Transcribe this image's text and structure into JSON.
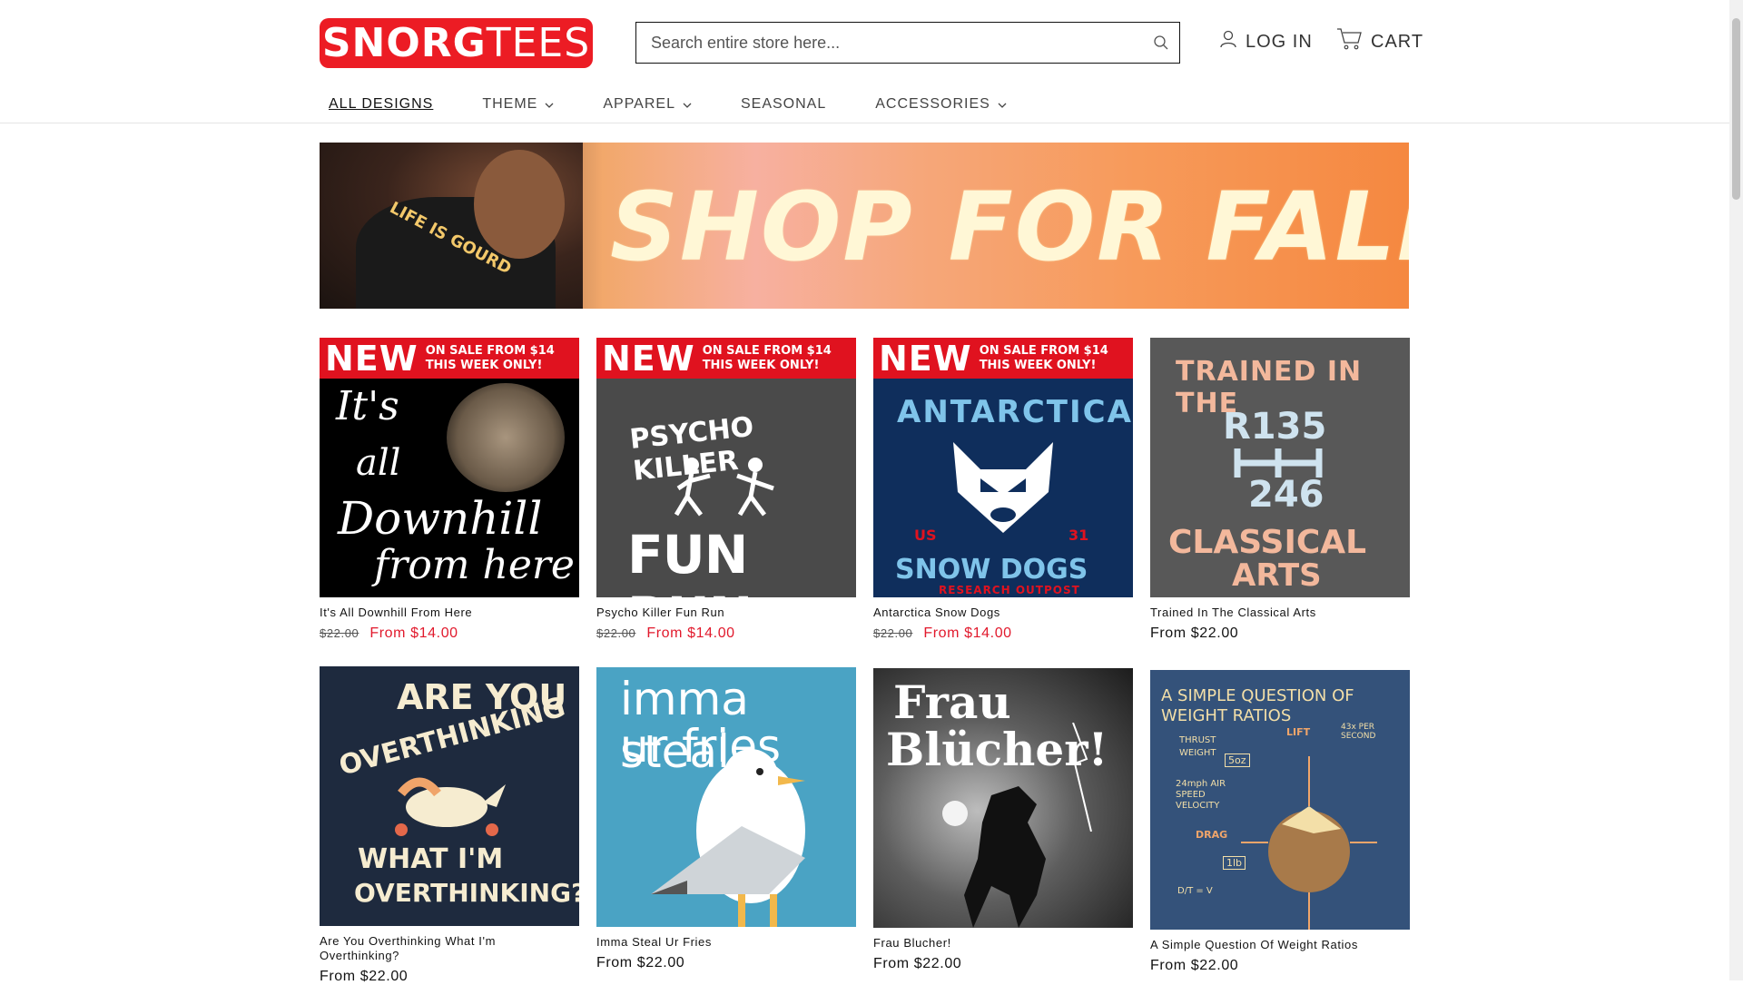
{
  "header": {
    "logo": {
      "bold": "SNORG",
      "thin": "TEES"
    },
    "search": {
      "placeholder": "Search entire store here..."
    },
    "login_label": "LOG IN",
    "cart_label": "CART"
  },
  "nav": {
    "items": [
      {
        "label": "ALL DESIGNS",
        "dropdown": false,
        "active": true
      },
      {
        "label": "THEME",
        "dropdown": true
      },
      {
        "label": "APPAREL",
        "dropdown": true
      },
      {
        "label": "SEASONAL",
        "dropdown": false
      },
      {
        "label": "ACCESSORIES",
        "dropdown": true
      }
    ]
  },
  "banner": {
    "headline": "SHOP FOR FALL",
    "shirt_text": "LIFE IS GOURD"
  },
  "sale_badge": {
    "new": "NEW",
    "line1": "ON SALE FROM $14",
    "line2": "THIS WEEK ONLY!"
  },
  "products": [
    {
      "title": "It's All Downhill From Here",
      "old_price": "$22.00",
      "price": "From $14.00",
      "art": [
        "It's",
        "all",
        "Downhill",
        "from here"
      ]
    },
    {
      "title": "Psycho Killer Fun Run",
      "old_price": "$22.00",
      "price": "From $14.00",
      "art": [
        "PSYCHO KILLER",
        "FUN RUN"
      ]
    },
    {
      "title": "Antarctica Snow Dogs",
      "old_price": "$22.00",
      "price": "From $14.00",
      "art": [
        "ANTARCTICA",
        "US",
        "31",
        "SNOW DOGS",
        "RESEARCH OUTPOST"
      ]
    },
    {
      "title": "Trained In The Classical Arts",
      "price": "From $22.00",
      "art": [
        "TRAINED IN THE",
        "R135",
        "246",
        "CLASSICAL",
        "ARTS"
      ]
    },
    {
      "title": "Are You Overthinking What I'm Overthinking?",
      "price": "From $22.00",
      "art": [
        "ARE YOU",
        "OVERTHINKING",
        "WHAT I'M",
        "OVERTHINKING?"
      ]
    },
    {
      "title": "Imma Steal Ur Fries",
      "price": "From $22.00",
      "art": [
        "imma steal",
        "ur fries"
      ]
    },
    {
      "title": "Frau Blucher!",
      "price": "From $22.00",
      "art": [
        "Frau",
        "Blücher!"
      ]
    },
    {
      "title": "A Simple Question Of Weight Ratios",
      "price": "From $22.00",
      "art": [
        "A SIMPLE QUESTION OF",
        "WEIGHT RATIOS",
        "THRUST",
        "WEIGHT",
        "LIFT",
        "43x PER SECOND",
        "5oz",
        "24mph AIR SPEED VELOCITY",
        "DRAG",
        "1lb",
        "D/T = V"
      ]
    }
  ],
  "colors": {
    "brand": "#ec1c24",
    "sale": "#e1192c"
  }
}
